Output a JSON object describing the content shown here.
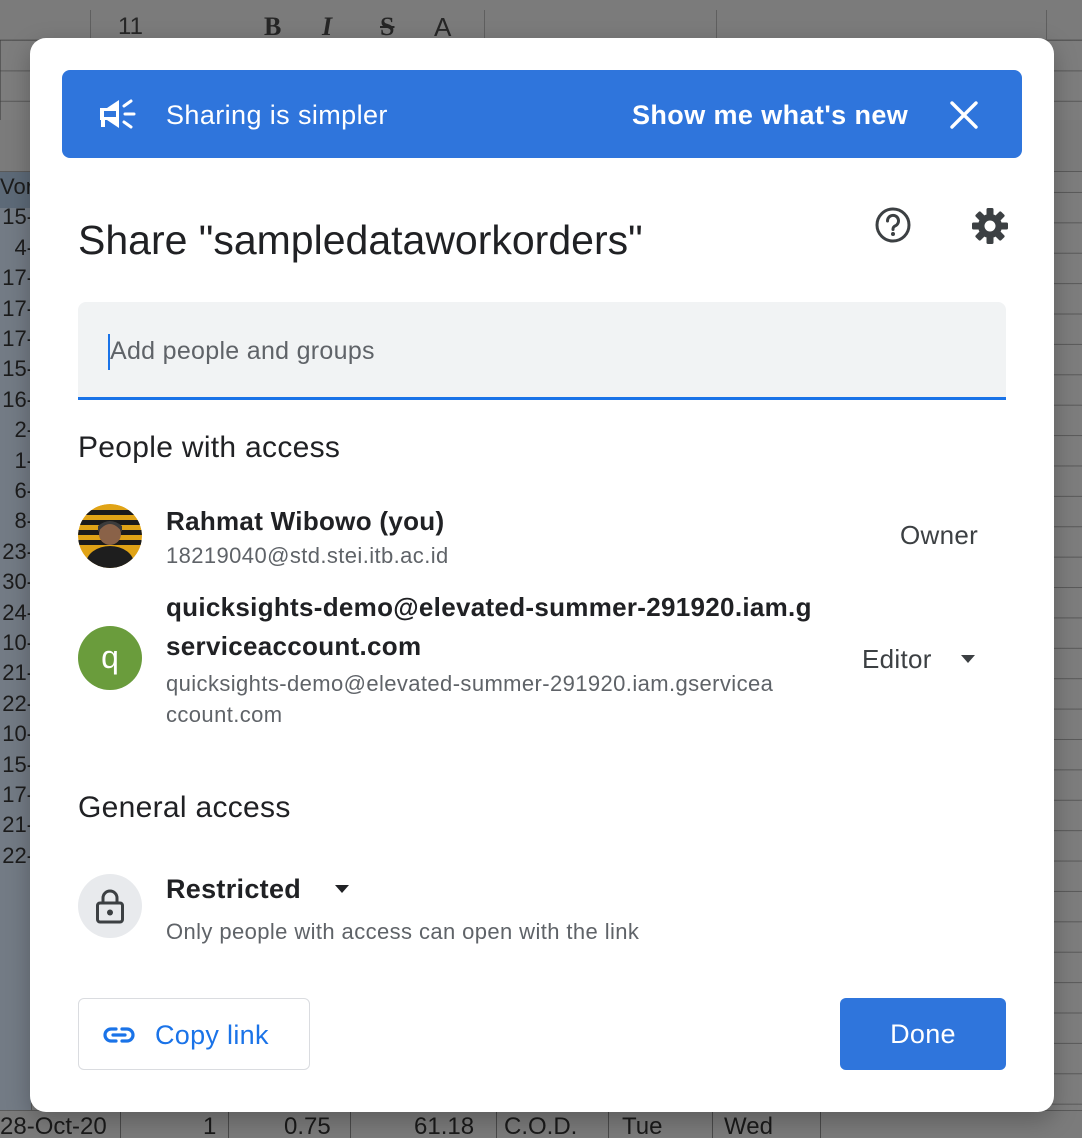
{
  "background": {
    "toolbar": {
      "font_size": "11",
      "bold": "B",
      "italic": "I",
      "strikethrough": "S",
      "text_color": "A"
    },
    "column_a_values": [
      "Vork",
      "15-",
      "4-",
      "17-",
      "17-",
      "17-",
      "15-",
      "16-",
      "2-",
      "1-",
      "6-",
      "8-",
      "23-",
      "30-",
      "24-",
      "10-",
      "21-",
      "22-",
      "10-",
      "15-",
      "17-",
      "21-",
      "22-"
    ],
    "last_row": [
      "28-Oct-20",
      "1",
      "0.75",
      "61.18",
      "C.O.D.",
      "Tue",
      "Wed"
    ]
  },
  "banner": {
    "text": "Sharing is simpler",
    "link": "Show me what's new"
  },
  "dialog": {
    "title": "Share \"sampledataworkorders\"",
    "add_placeholder": "Add people and groups"
  },
  "people_section": {
    "heading": "People with access",
    "people": [
      {
        "name": "Rahmat Wibowo (you)",
        "email": "18219040@std.stei.itb.ac.id",
        "role": "Owner"
      },
      {
        "avatar_letter": "q",
        "name_line1": "quicksights-demo@elevated-summer-291920.iam.g",
        "name_line2": "serviceaccount.com",
        "email_line1": "quicksights-demo@elevated-summer-291920.iam.gservicea",
        "email_line2": "ccount.com",
        "role": "Editor",
        "avatar_color": "#6a9c3c"
      }
    ]
  },
  "general_access": {
    "heading": "General access",
    "mode": "Restricted",
    "description": "Only people with access can open with the link"
  },
  "footer": {
    "copy_link": "Copy link",
    "done": "Done"
  },
  "colors": {
    "accent": "#1a73e8",
    "banner": "#2f75dc"
  },
  "icons": [
    "megaphone-icon",
    "close-icon",
    "help-icon",
    "gear-icon",
    "lock-icon",
    "link-icon",
    "dropdown-arrow-icon"
  ]
}
